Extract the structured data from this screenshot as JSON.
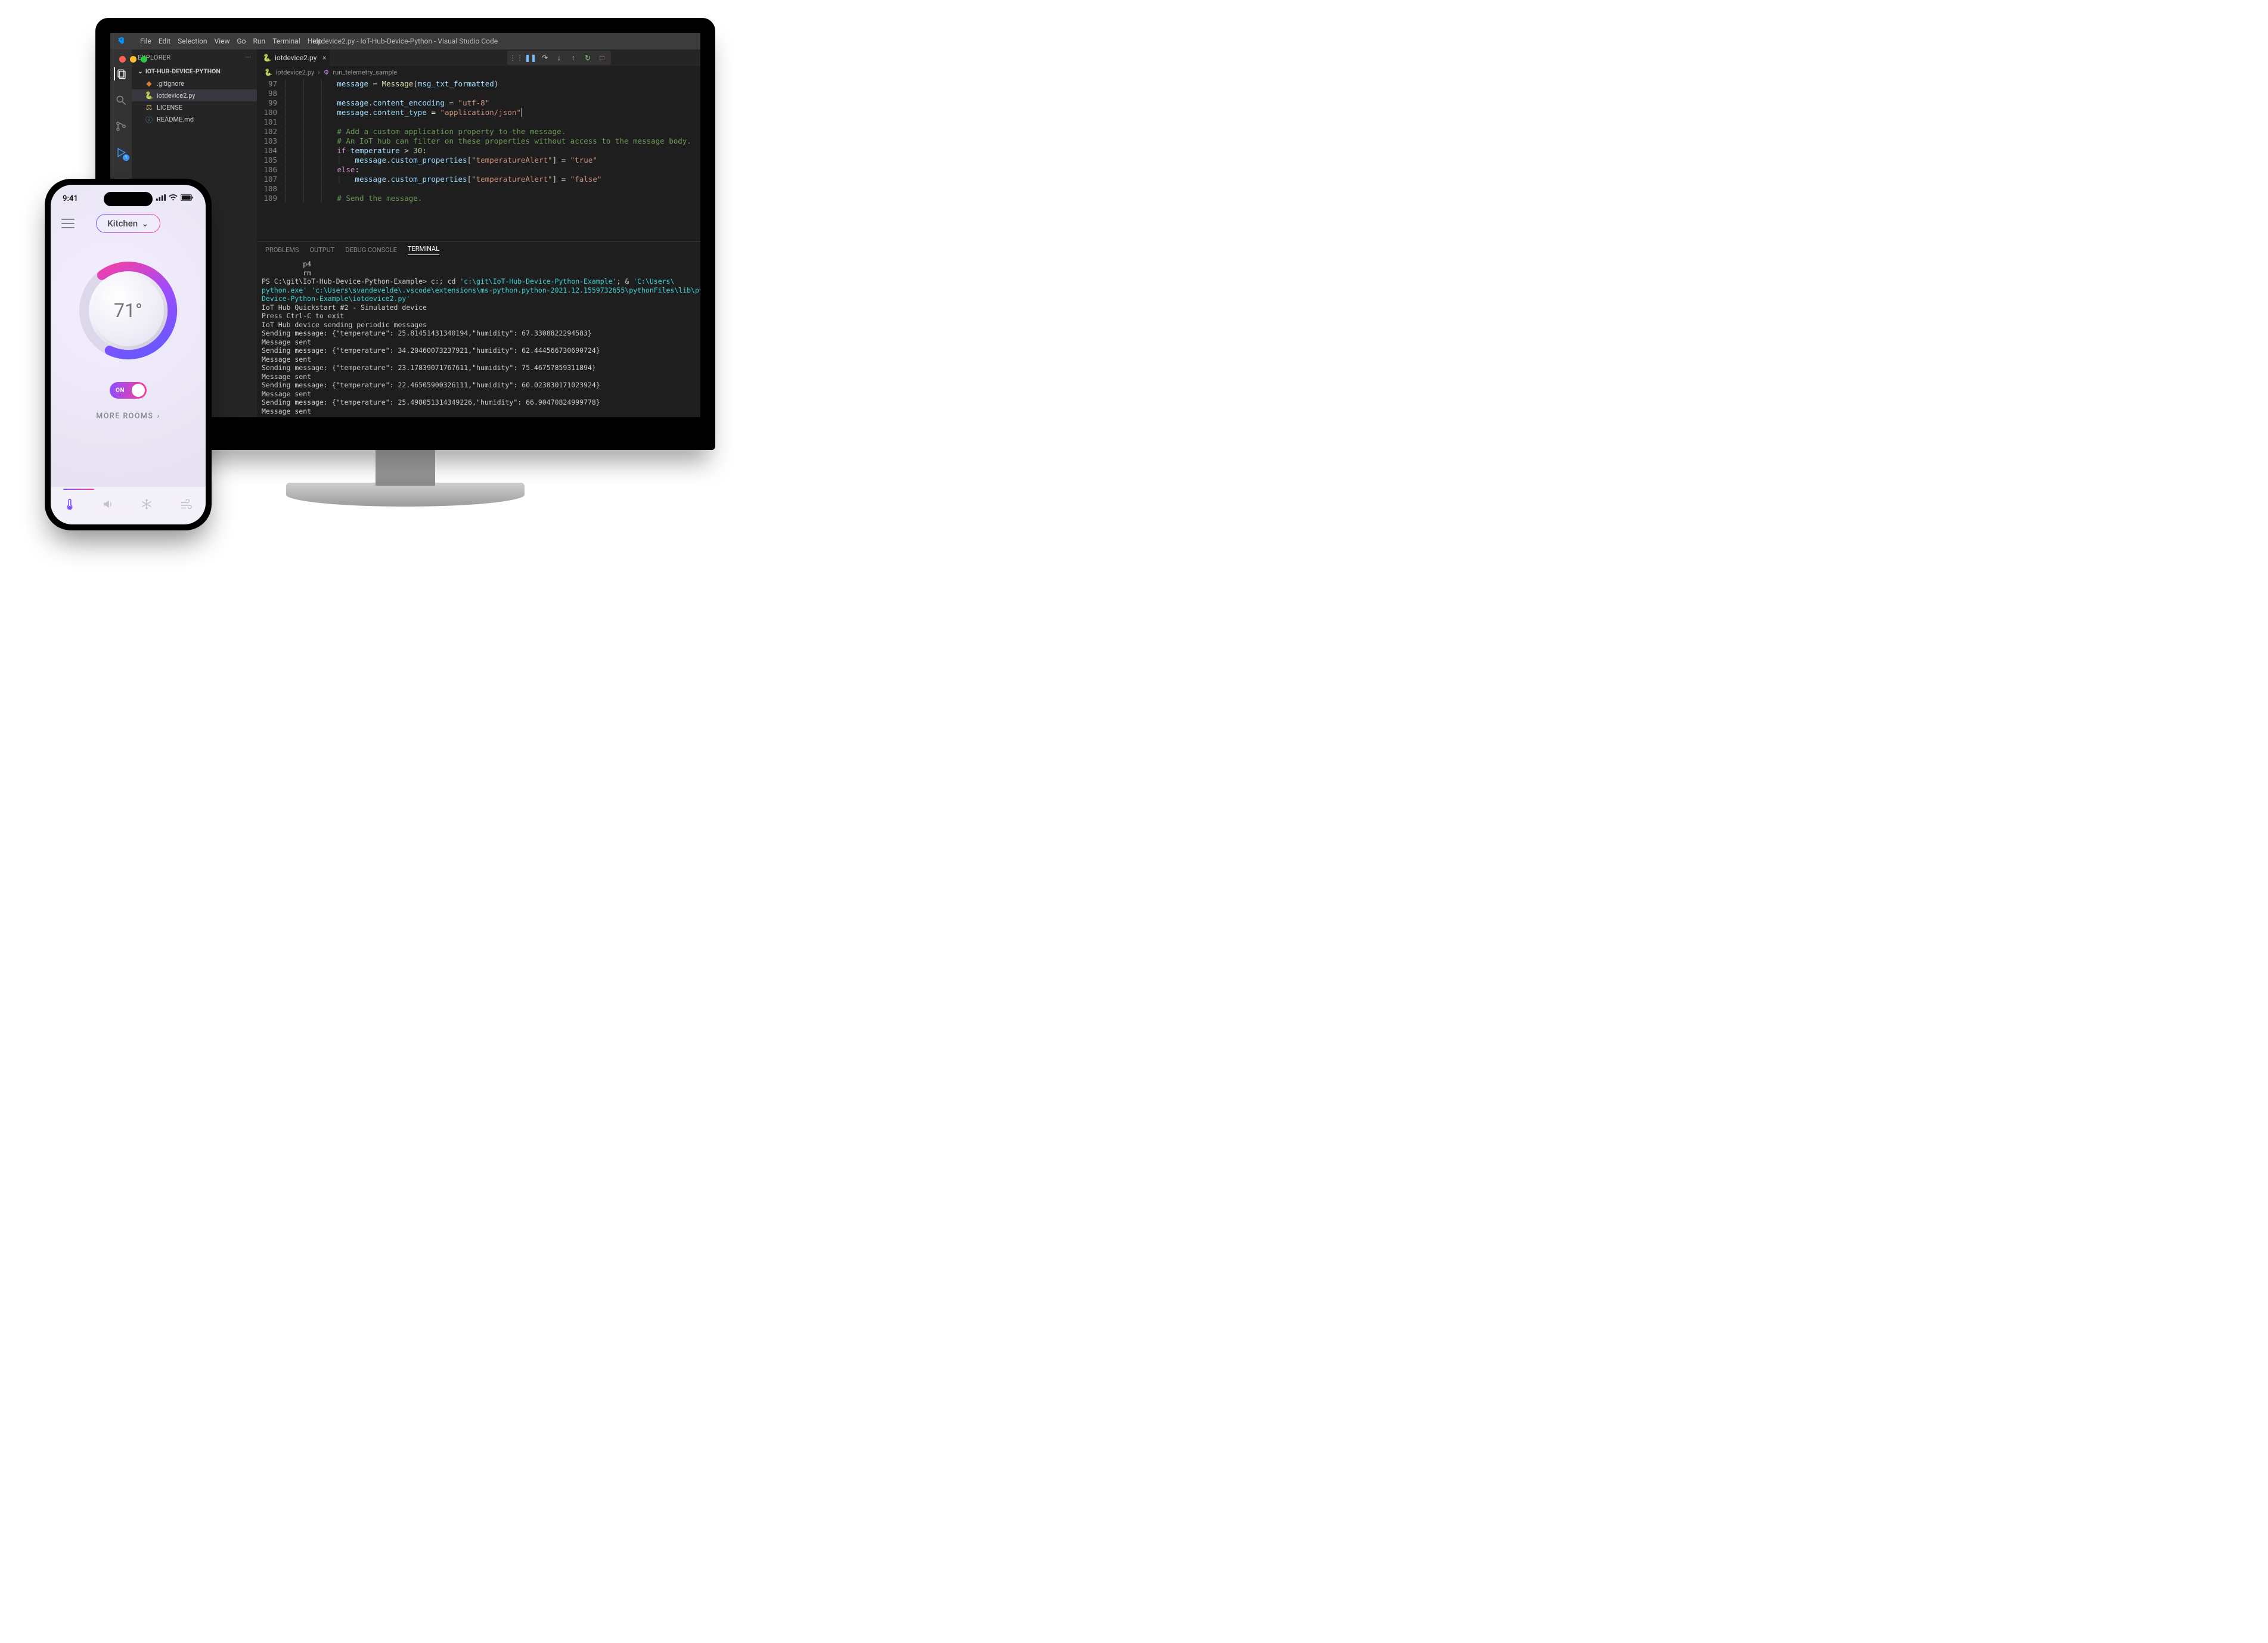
{
  "vscode": {
    "window_title": "iotdevice2.py - IoT-Hub-Device-Python - Visual Studio Code",
    "menu": [
      "File",
      "Edit",
      "Selection",
      "View",
      "Go",
      "Run",
      "Terminal",
      "Help"
    ],
    "explorer_label": "EXPLORER",
    "folder_name": "IOT-HUB-DEVICE-PYTHON",
    "files": [
      {
        "icon": "gitignore",
        "label": ".gitignore"
      },
      {
        "icon": "python",
        "label": "iotdevice2.py",
        "active": true
      },
      {
        "icon": "license",
        "label": "LICENSE"
      },
      {
        "icon": "info",
        "label": "README.md"
      }
    ],
    "open_tab": "iotdevice2.py",
    "breadcrumb": {
      "file": "iotdevice2.py",
      "symbol": "run_telemetry_sample"
    },
    "code_lines": {
      "97": "message = Message(msg_txt_formatted)",
      "98": "",
      "99": "message.content_encoding = \"utf-8\"",
      "100": "message.content_type = \"application/json\"",
      "101": "",
      "102": "# Add a custom application property to the message.",
      "103": "# An IoT hub can filter on these properties without access to the message body.",
      "104": "if temperature > 30:",
      "105": "    message.custom_properties[\"temperatureAlert\"] = \"true\"",
      "106": "else:",
      "107": "    message.custom_properties[\"temperatureAlert\"] = \"false\"",
      "108": "",
      "109": "# Send the message."
    },
    "panel_tabs": [
      "PROBLEMS",
      "OUTPUT",
      "DEBUG CONSOLE",
      "TERMINAL"
    ],
    "active_panel_tab": "TERMINAL",
    "terminal": {
      "pre": [
        "          p4",
        "          rm"
      ],
      "prompt_prefix": "PS C:\\git\\IoT-Hub-Device-Python-Example> ",
      "cmd_parts": {
        "a": "c:; cd ",
        "b": "'c:\\git\\IoT-Hub-Device-Python-Example'",
        "c": "; & ",
        "d": "'C:\\Users\\",
        "e": "python.exe' 'c:\\Users\\svandevelde\\.vscode\\extensions\\ms-python.python-2021.12.1559732655\\pythonFiles\\lib\\python\\",
        "f": "Device-Python-Example\\iotdevice2.py'"
      },
      "lines": [
        "IoT Hub Quickstart #2 - Simulated device",
        "Press Ctrl-C to exit",
        "IoT Hub device sending periodic messages",
        "Sending message: {\"temperature\": 25.81451431340194,\"humidity\": 67.3308822294583}",
        "Message sent",
        "Sending message: {\"temperature\": 34.20460073237921,\"humidity\": 62.444566730690724}",
        "Message sent",
        "Sending message: {\"temperature\": 23.17839071767611,\"humidity\": 75.46757859311894}",
        "Message sent",
        "Sending message: {\"temperature\": 22.46505900326111,\"humidity\": 60.023830171023924}",
        "Message sent",
        "Sending message: {\"temperature\": 25.498051314349226,\"humidity\": 66.90470824999778}",
        "Message sent"
      ]
    }
  },
  "phone": {
    "status_time": "9:41",
    "room_label": "Kitchen",
    "temperature": "71°",
    "toggle_label": "ON",
    "more_label": "MORE ROOMS",
    "tab_items": [
      "thermometer",
      "speaker",
      "snowflake",
      "wind"
    ],
    "active_tab_index": 0
  }
}
